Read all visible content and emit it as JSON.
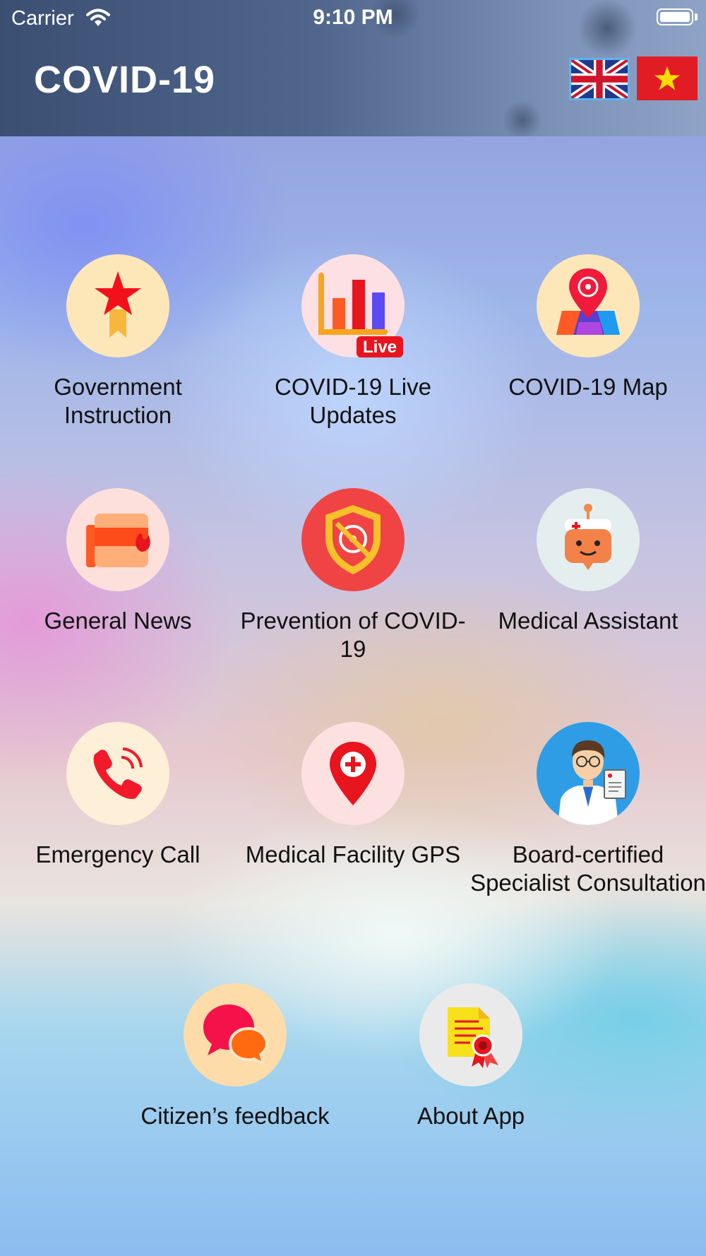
{
  "status_bar": {
    "carrier": "Carrier",
    "time": "9:10 PM"
  },
  "header": {
    "title": "COVID-19",
    "languages": [
      {
        "name": "English",
        "icon": "uk-flag-icon"
      },
      {
        "name": "Vietnamese",
        "icon": "vietnam-flag-icon"
      }
    ]
  },
  "menu": {
    "items": [
      {
        "label": "Government Instruction",
        "icon": "star-medal-icon"
      },
      {
        "label": "COVID-19 Live Updates",
        "icon": "bar-chart-icon",
        "badge": "Live"
      },
      {
        "label": "COVID-19 Map",
        "icon": "map-pin-icon"
      },
      {
        "label": "General News",
        "icon": "newspaper-icon"
      },
      {
        "label": "Prevention of COVID-19",
        "icon": "virus-shield-icon"
      },
      {
        "label": "Medical Assistant",
        "icon": "nurse-bot-icon"
      },
      {
        "label": "Emergency Call",
        "icon": "phone-icon"
      },
      {
        "label": "Medical Facility GPS",
        "icon": "medical-location-icon"
      },
      {
        "label": "Board-certified Specialist Consultation",
        "icon": "doctor-icon"
      },
      {
        "label": "Citizen’s feedback",
        "icon": "chat-bubbles-icon"
      },
      {
        "label": "About App",
        "icon": "certificate-icon"
      }
    ]
  },
  "colors": {
    "header_bg": "#4a5f85",
    "label_text": "#111111",
    "accent_red": "#e8282e",
    "accent_orange": "#ff7a1a"
  }
}
